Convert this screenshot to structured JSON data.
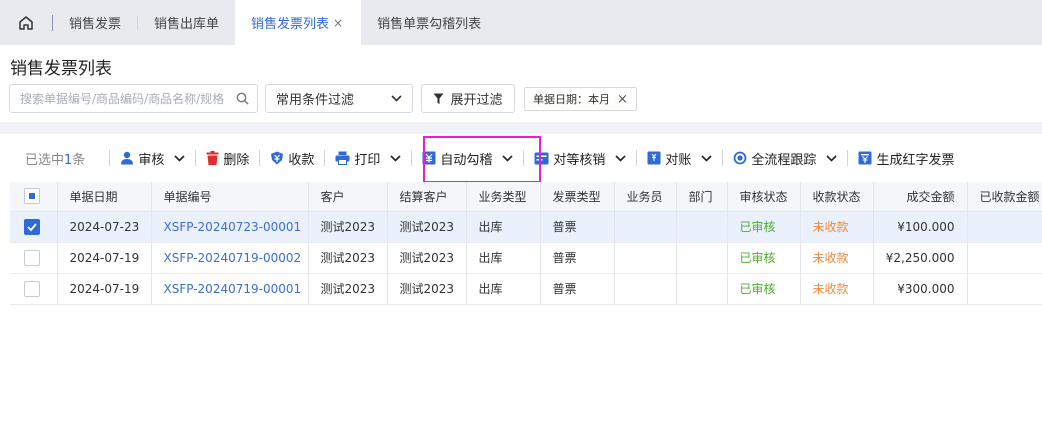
{
  "tabs": [
    {
      "label": "销售发票",
      "active": false
    },
    {
      "label": "销售出库单",
      "active": false
    },
    {
      "label": "销售发票列表",
      "active": true,
      "close": "×"
    },
    {
      "label": "销售单票勾稽列表",
      "active": false
    }
  ],
  "header": {
    "title": "销售发票列表",
    "search_placeholder": "搜索单据编号/商品编码/商品名称/规格",
    "filter_select": "常用条件过滤",
    "expand_filter": "展开过滤",
    "chip_label": "单据日期：本月",
    "chip_close": "×"
  },
  "toolbar": {
    "selected_prefix": "已选中",
    "selected_count": "1",
    "selected_suffix": "条",
    "buttons": {
      "approve": "审核",
      "delete": "删除",
      "receive": "收款",
      "print": "打印",
      "auto_reconcile": "自动勾稽",
      "peer_writeoff": "对等核销",
      "reconcile": "对账",
      "trace": "全流程跟踪",
      "red_invoice": "生成红字发票"
    }
  },
  "table": {
    "columns": [
      "单据日期",
      "单据编号",
      "客户",
      "结算客户",
      "业务类型",
      "发票类型",
      "业务员",
      "部门",
      "审核状态",
      "收款状态",
      "成交金额",
      "已收款金额"
    ],
    "rows": [
      {
        "selected": true,
        "date": "2024-07-23",
        "code": "XSFP-20240723-00001",
        "customer": "测试2023",
        "settle_customer": "测试2023",
        "biz_type": "出库",
        "invoice_type": "普票",
        "salesperson": "",
        "dept": "",
        "audit": "已审核",
        "payment": "未收款",
        "amount": "¥100.000",
        "received": ""
      },
      {
        "selected": false,
        "date": "2024-07-19",
        "code": "XSFP-20240719-00002",
        "customer": "测试2023",
        "settle_customer": "测试2023",
        "biz_type": "出库",
        "invoice_type": "普票",
        "salesperson": "",
        "dept": "",
        "audit": "已审核",
        "payment": "未收款",
        "amount": "¥2,250.000",
        "received": ""
      },
      {
        "selected": false,
        "date": "2024-07-19",
        "code": "XSFP-20240719-00001",
        "customer": "测试2023",
        "settle_customer": "测试2023",
        "biz_type": "出库",
        "invoice_type": "普票",
        "salesperson": "",
        "dept": "",
        "audit": "已审核",
        "payment": "未收款",
        "amount": "¥300.000",
        "received": ""
      }
    ]
  },
  "colors": {
    "accent": "#2f6bd8",
    "approved": "#4caf2a",
    "unpaid": "#f08a3c",
    "highlight": "#e61ed4",
    "delete_red": "#e02d2d"
  }
}
